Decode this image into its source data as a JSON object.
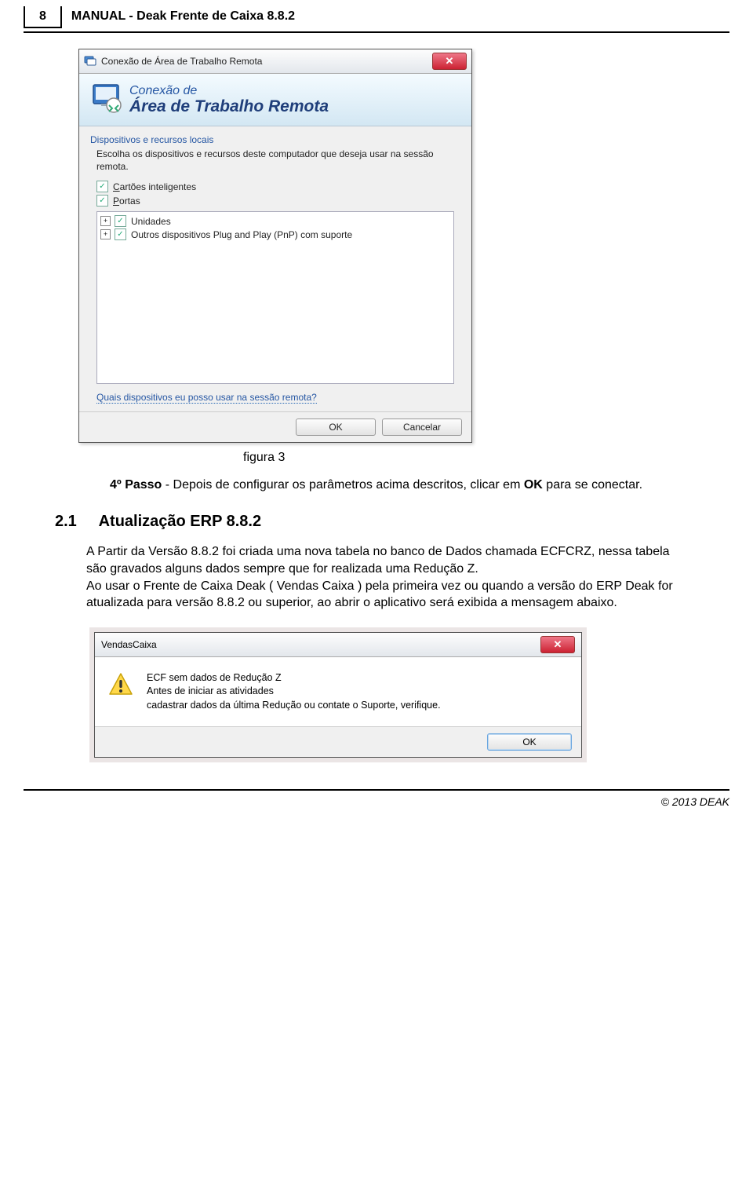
{
  "header": {
    "page_number": "8",
    "title": "MANUAL - Deak Frente de Caixa 8.8.2"
  },
  "rdp": {
    "title": "Conexão de Área de Trabalho Remota",
    "banner_line1": "Conexão de",
    "banner_line2": "Área de Trabalho Remota",
    "group_label": "Dispositivos e recursos locais",
    "group_desc": "Escolha os dispositivos e recursos deste computador que deseja usar na sessão remota.",
    "chk_smartcards": "Cartões inteligentes",
    "chk_ports": "Portas",
    "tree_units": "Unidades",
    "tree_pnp": "Outros dispositivos Plug and Play (PnP) com suporte",
    "help_link": "Quais dispositivos eu posso usar na sessão remota?",
    "btn_ok": "OK",
    "btn_cancel": "Cancelar",
    "close_glyph": "✕"
  },
  "doc": {
    "fig_caption": "figura 3",
    "step4_label": "4º Passo",
    "step4_sep": " -  ",
    "step4_a": "Depois de configurar os parâmetros acima descritos, clicar em ",
    "step4_ok": "OK",
    "step4_b": " para se conectar.",
    "section_num": "2.1",
    "section_title": "Atualização ERP 8.8.2",
    "body": "A Partir da Versão 8.8.2 foi criada uma nova tabela no banco de Dados chamada ECFCRZ, nessa tabela são gravados alguns dados sempre que for realizada uma Redução Z.\nAo usar o Frente de Caixa Deak ( Vendas Caixa ) pela primeira vez ou quando a versão do ERP Deak for atualizada para versão 8.8.2 ou superior, ao abrir o aplicativo será exibida a mensagem abaixo."
  },
  "vc": {
    "title": "VendasCaixa",
    "line1": "ECF sem dados de Redução Z",
    "line2": "Antes de iniciar as atividades",
    "line3": "cadastrar dados da última Redução ou contate o Suporte, verifique.",
    "btn_ok": "OK",
    "close_glyph": "✕"
  },
  "footer": {
    "copyright": "© 2013 DEAK"
  }
}
